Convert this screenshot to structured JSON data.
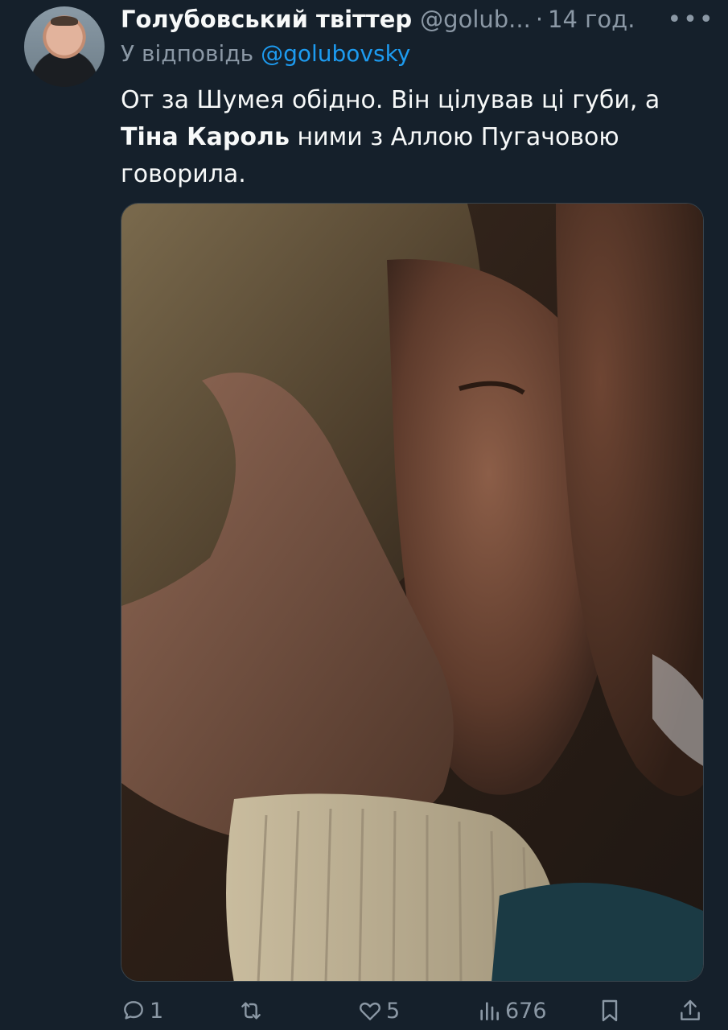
{
  "tweet": {
    "author_name": "Голубовський твіттер",
    "author_handle": "@golub...",
    "separator": "·",
    "time": "14 год.",
    "more": "•••",
    "reply_prefix": "У відповідь",
    "reply_to": "@golubovsky",
    "text_part1": "От за Шумея обідно. Він цілував ці губи, а ",
    "text_bold": "Тіна Кароль",
    "text_part2": " ними з Аллою Пугачовою говорила."
  },
  "actions": {
    "replies": "1",
    "retweets": "",
    "likes": "5",
    "views": "676"
  },
  "icons": {
    "reply": "comment-icon",
    "retweet": "retweet-icon",
    "like": "heart-icon",
    "views": "views-chart-icon",
    "bookmark": "bookmark-icon",
    "share": "share-icon"
  },
  "colors": {
    "background": "#15202b",
    "text": "#f7f9f9",
    "secondary": "#8b98a5",
    "accent": "#1d9bf0"
  }
}
